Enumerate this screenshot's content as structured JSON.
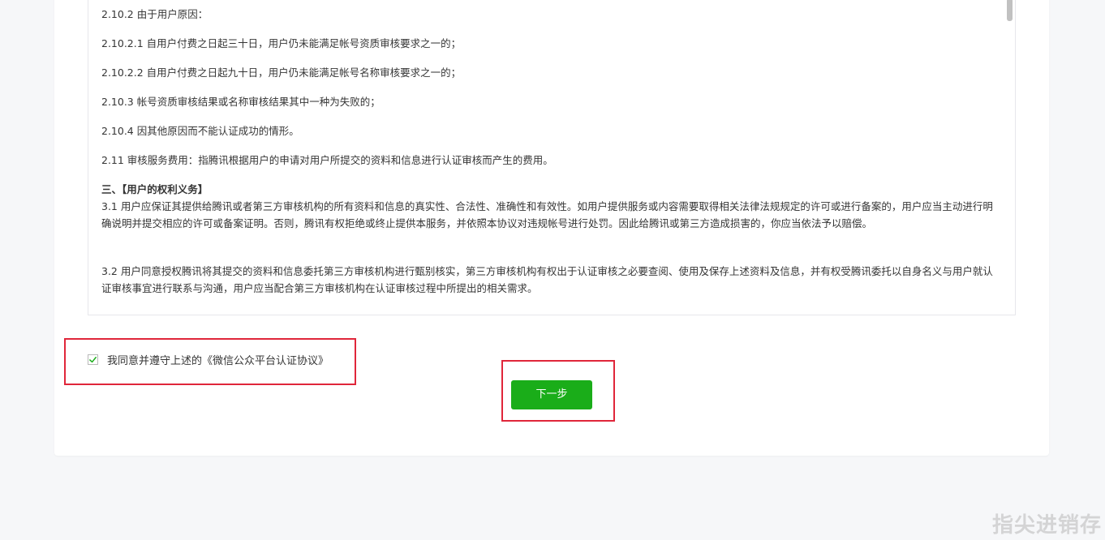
{
  "agreement": {
    "paragraphs": [
      {
        "id": "p1",
        "text": "2.10.2 由于用户原因："
      },
      {
        "id": "p2",
        "text": "2.10.2.1 自用户付费之日起三十日，用户仍未能满足帐号资质审核要求之一的；"
      },
      {
        "id": "p3",
        "text": "2.10.2.2 自用户付费之日起九十日，用户仍未能满足帐号名称审核要求之一的；"
      },
      {
        "id": "p4",
        "text": "2.10.3 帐号资质审核结果或名称审核结果其中一种为失败的；"
      },
      {
        "id": "p5",
        "text": "2.10.4 因其他原因而不能认证成功的情形。"
      },
      {
        "id": "p6",
        "text": "2.11 审核服务费用：指腾讯根据用户的申请对用户所提交的资料和信息进行认证审核而产生的费用。"
      },
      {
        "id": "h1",
        "text": "三、【用户的权利义务】"
      },
      {
        "id": "p7",
        "text": "3.1 用户应保证其提供给腾讯或者第三方审核机构的所有资料和信息的真实性、合法性、准确性和有效性。如用户提供服务或内容需要取得相关法律法规规定的许可或进行备案的，用户应当主动进行明确说明并提交相应的许可或备案证明。否则，腾讯有权拒绝或终止提供本服务，并依照本协议对违规帐号进行处罚。因此给腾讯或第三方造成损害的，你应当依法予以赔偿。"
      },
      {
        "id": "p8",
        "text": "3.2 用户同意授权腾讯将其提交的资料和信息委托第三方审核机构进行甄别核实，第三方审核机构有权出于认证审核之必要查阅、使用及保存上述资料及信息，并有权受腾讯委托以自身名义与用户就认证审核事宜进行联系与沟通，用户应当配合第三方审核机构在认证审核过程中所提出的相关需求。"
      }
    ]
  },
  "agree": {
    "label": "我同意并遵守上述的《微信公众平台认证协议》",
    "checked": true,
    "check_icon": "check-icon"
  },
  "next_button": {
    "label": "下一步"
  },
  "watermark": {
    "text": "指尖进销存"
  },
  "colors": {
    "primary_green": "#1aad19",
    "highlight_red": "#e0263a",
    "check_green": "#1aad19"
  }
}
